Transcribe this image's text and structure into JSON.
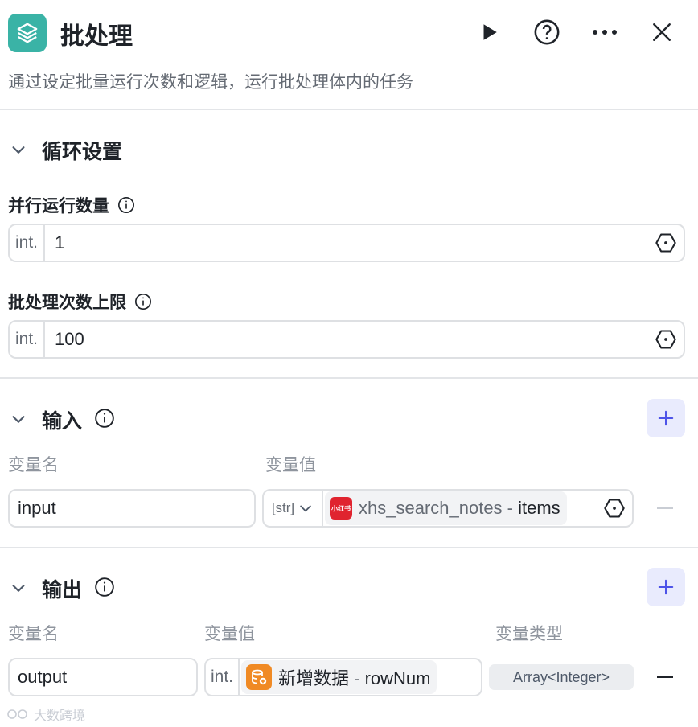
{
  "header": {
    "title": "批处理",
    "description": "通过设定批量运行次数和逻辑，运行批处理体内的任务"
  },
  "loop_section": {
    "title": "循环设置",
    "parallel": {
      "label": "并行运行数量",
      "type": "int.",
      "value": "1"
    },
    "max_count": {
      "label": "批处理次数上限",
      "type": "int.",
      "value": "100"
    }
  },
  "input_section": {
    "title": "输入",
    "col_name": "变量名",
    "col_value": "变量值",
    "row": {
      "name": "input",
      "type": "[str]",
      "ref_badge": "小红书",
      "ref_node": "xhs_search_notes",
      "ref_sep": " - ",
      "ref_field": "items"
    }
  },
  "output_section": {
    "title": "输出",
    "col_name": "变量名",
    "col_value": "变量值",
    "col_type": "变量类型",
    "row": {
      "name": "output",
      "type": "int.",
      "ref_node": "新增数据",
      "ref_sep": " - ",
      "ref_field": "rowNum",
      "var_type": "Array<Integer>"
    }
  },
  "watermark": "大数跨境",
  "colors": {
    "accent": "#3ab3a6",
    "add_button_bg": "#e9ebfd",
    "add_button_fg": "#4d53e8",
    "xhs_red": "#e0242f",
    "db_orange": "#f08a24"
  }
}
